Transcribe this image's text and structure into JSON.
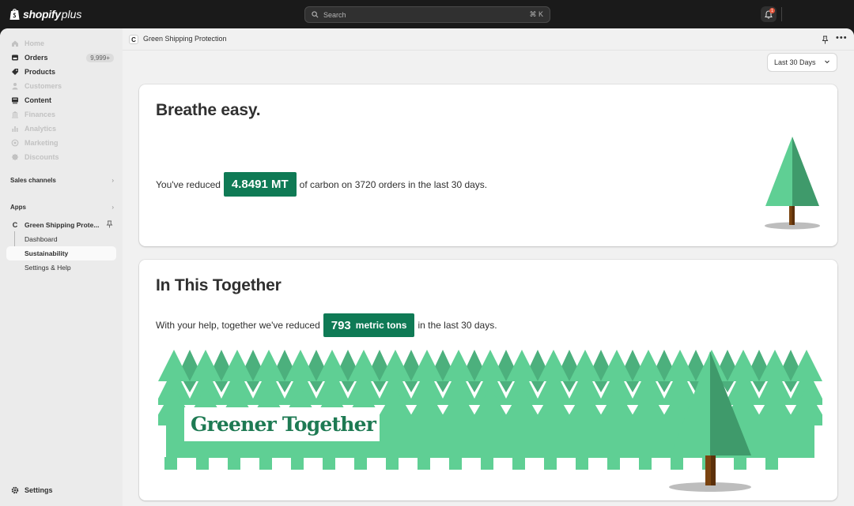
{
  "topbar": {
    "logo_text_bold": "shopify",
    "logo_text_plus": "plus",
    "search_placeholder": "Search",
    "search_shortcut": "⌘ K",
    "notification_count": "1"
  },
  "sidebar": {
    "items": [
      {
        "label": "Home",
        "icon": "home-icon",
        "enabled": false
      },
      {
        "label": "Orders",
        "icon": "orders-icon",
        "enabled": true,
        "badge": "9,999+"
      },
      {
        "label": "Products",
        "icon": "tag-icon",
        "enabled": true
      },
      {
        "label": "Customers",
        "icon": "person-icon",
        "enabled": false
      },
      {
        "label": "Content",
        "icon": "content-icon",
        "enabled": true
      },
      {
        "label": "Finances",
        "icon": "bank-icon",
        "enabled": false
      },
      {
        "label": "Analytics",
        "icon": "bar-chart-icon",
        "enabled": false
      },
      {
        "label": "Marketing",
        "icon": "target-icon",
        "enabled": false
      },
      {
        "label": "Discounts",
        "icon": "discount-icon",
        "enabled": false
      }
    ],
    "sales_channels": "Sales channels",
    "apps": "Apps",
    "app_name": "Green Shipping Prote...",
    "app_sub": [
      "Dashboard",
      "Sustainability",
      "Settings & Help"
    ],
    "settings": "Settings"
  },
  "header": {
    "app_icon_letter": "C",
    "title": "Green Shipping Protection"
  },
  "range_select": {
    "value": "Last 30 Days"
  },
  "card1": {
    "title": "Breathe easy.",
    "text_before": "You've reduced",
    "highlight": "4.8491 MT",
    "text_after": "of carbon on 3720 orders in the last 30 days."
  },
  "card2": {
    "title": "In This Together",
    "text_before": "With your help, together we've reduced",
    "highlight_number": "793",
    "highlight_unit": "metric tons",
    "text_after": "in the last 30 days.",
    "banner": "Greener Together"
  },
  "colors": {
    "accent": "#0f7a55",
    "tree_light": "#5fcf94",
    "tree_dark": "#3f9a6b",
    "trunk": "#7b4410"
  }
}
